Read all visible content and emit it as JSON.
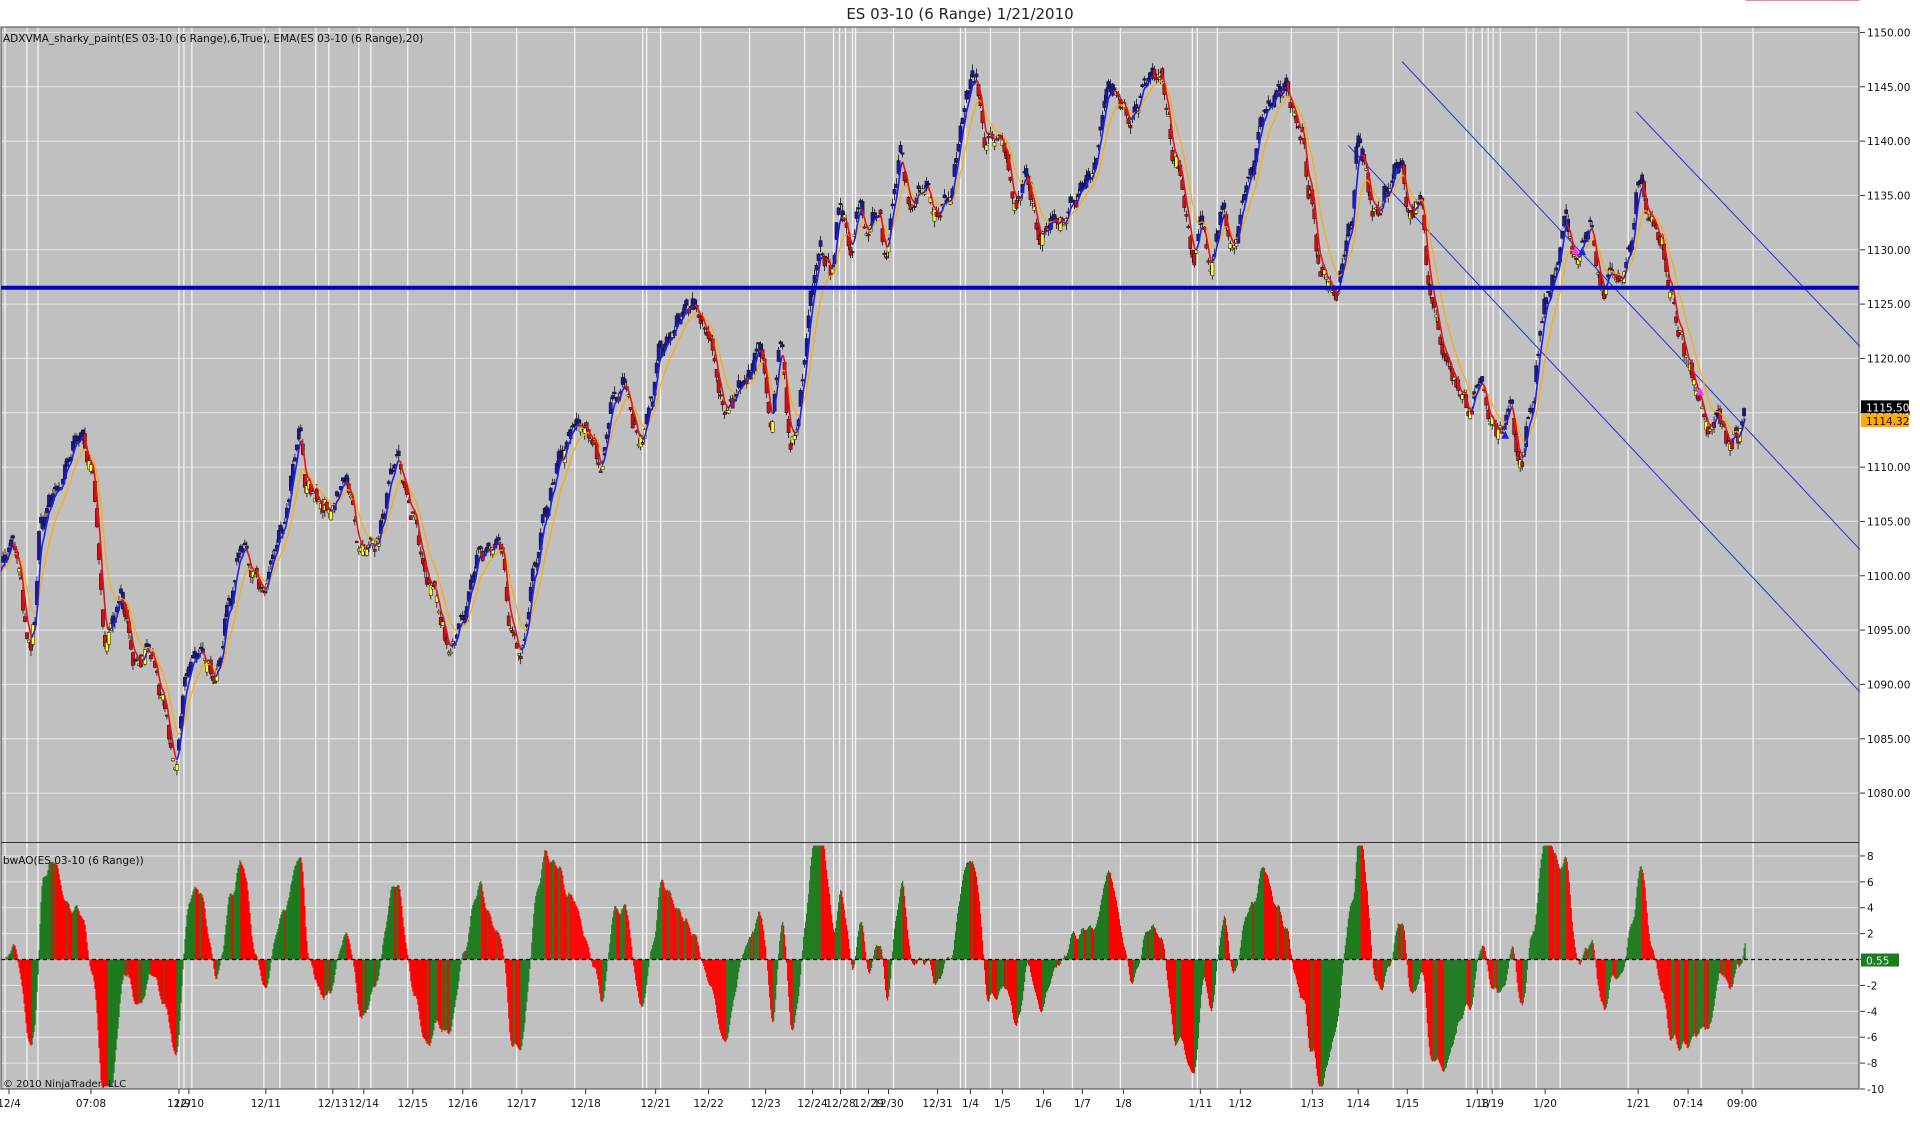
{
  "window": {
    "title": "ES 03-10 (6 Range)  1/21/2010",
    "copyright": "© 2010 NinjaTrader, LLC"
  },
  "colors": {
    "panel_bg": "#c0c0c0",
    "page_bg": "#ffffff",
    "grid": "#e6e6e6",
    "session_line": "#f4f4f4",
    "bull_candle": "#ffff33",
    "bear_candle": "#cc1111",
    "trend_up_candle": "#1a1a99",
    "adxvma_up": "#2020ee",
    "adxvma_down": "#ee1111",
    "ema": "#ffaa00",
    "support_line": "#0000cc",
    "channel": "#2233dd",
    "ao_up": "#1e7a1e",
    "ao_down": "#ff0000",
    "magenta": "#ff33ff"
  },
  "chart_data": [
    {
      "type": "candlestick",
      "panel": "price",
      "label": "ADXVMA_sharky_paint(ES 03-10 (6 Range),6,True), EMA(ES 03-10 (6 Range),20)",
      "ylim": [
        1075.5,
        1150.5
      ],
      "y_ticks": [
        "1150.00",
        "1145.00",
        "1140.00",
        "1135.00",
        "1130.00",
        "1125.00",
        "1120.00",
        "1115.00",
        "1110.00",
        "1105.00",
        "1100.00",
        "1095.00",
        "1090.00",
        "1085.00",
        "1080.00"
      ],
      "y_tick_values": [
        1150,
        1145,
        1140,
        1135,
        1130,
        1125,
        1120,
        1115,
        1110,
        1105,
        1100,
        1095,
        1090,
        1085,
        1080
      ],
      "x_labels": [
        "12/4",
        "07:08",
        "12/9",
        "12/10",
        "12/11",
        "12/13",
        "12/14",
        "12/15",
        "12/16",
        "12/17",
        "12/18",
        "12/21",
        "12/22",
        "12/23",
        "12/24",
        "12/28",
        "12/29",
        "12/30",
        "12/31",
        "1/4",
        "1/5",
        "1/6",
        "1/7",
        "1/8",
        "1/11",
        "1/12",
        "1/13",
        "1/14",
        "1/15",
        "1/18",
        "1/19",
        "1/20",
        "1/21",
        "07:14",
        "09:00"
      ],
      "x_label_bar_index": [
        8,
        90,
        178,
        188,
        265,
        332,
        363,
        412,
        462,
        521,
        585,
        655,
        708,
        765,
        812,
        840,
        868,
        888,
        937,
        970,
        1002,
        1043,
        1082,
        1123,
        1200,
        1240,
        1312,
        1358,
        1407,
        1477,
        1492,
        1545,
        1638,
        1688,
        1742
      ],
      "session_line_bar_index": [
        4,
        26,
        37,
        178,
        183,
        191,
        263,
        279,
        315,
        328,
        358,
        370,
        407,
        454,
        470,
        516,
        574,
        642,
        646,
        660,
        700,
        749,
        804,
        833,
        839,
        845,
        852,
        855,
        893,
        960,
        965,
        990,
        1019,
        1072,
        1120,
        1192,
        1197,
        1217,
        1291,
        1338,
        1393,
        1423,
        1466,
        1473,
        1482,
        1488,
        1493,
        1500,
        1536,
        1560,
        1628,
        1701,
        1753
      ],
      "close_anchor_bar_index": [
        0,
        12,
        30,
        33,
        40,
        55,
        80,
        90,
        105,
        120,
        135,
        150,
        160,
        175,
        180,
        185,
        195,
        215,
        230,
        240,
        255,
        262,
        270,
        280,
        300,
        305,
        330,
        345,
        360,
        375,
        395,
        410,
        430,
        450,
        462,
        478,
        500,
        510,
        520,
        535,
        545,
        560,
        575,
        590,
        600,
        612,
        625,
        632,
        640,
        650,
        660,
        690,
        705,
        725,
        745,
        760,
        771,
        780,
        790,
        820,
        830,
        840,
        850,
        860,
        865,
        878,
        885,
        895,
        900,
        910,
        925,
        935,
        950,
        960,
        968,
        975,
        985,
        1002,
        1015,
        1025,
        1040,
        1055,
        1062,
        1070,
        1090,
        1110,
        1130,
        1148,
        1160,
        1175,
        1195,
        1200,
        1210,
        1222,
        1232,
        1250,
        1265,
        1285,
        1300,
        1310,
        1320,
        1335,
        1350,
        1358,
        1375,
        1385,
        1400,
        1410,
        1420,
        1430,
        1445,
        1460,
        1470,
        1480,
        1492,
        1500,
        1510,
        1520,
        1530,
        1545,
        1555,
        1565,
        1575,
        1590,
        1602,
        1612,
        1620,
        1630,
        1640,
        1648,
        1660,
        1670,
        1680,
        1690,
        1700,
        1708,
        1718,
        1728,
        1738,
        1745,
        1752,
        1760
      ],
      "close_anchor_values": [
        1101,
        1103,
        1093,
        1096,
        1105,
        1108,
        1113,
        1110,
        1094,
        1098,
        1092,
        1093,
        1089,
        1082,
        1087,
        1091,
        1093,
        1091,
        1098,
        1103,
        1100,
        1098,
        1101,
        1104,
        1113,
        1108,
        1106,
        1109,
        1102,
        1103,
        1111,
        1106,
        1099,
        1093,
        1096,
        1102,
        1103,
        1095,
        1093,
        1101,
        1106,
        1111,
        1114,
        1113,
        1110,
        1116,
        1118,
        1114,
        1112,
        1116,
        1121,
        1125,
        1123,
        1115,
        1118,
        1121,
        1114,
        1122,
        1112,
        1130,
        1128,
        1134,
        1130,
        1135,
        1131,
        1134,
        1129,
        1136,
        1139,
        1134,
        1136,
        1133,
        1135,
        1141,
        1145,
        1146,
        1140,
        1140,
        1134,
        1137,
        1131,
        1133,
        1132,
        1134,
        1137,
        1145,
        1142,
        1146,
        1146,
        1138,
        1129,
        1133,
        1128,
        1134,
        1130,
        1137,
        1143,
        1145,
        1141,
        1135,
        1128,
        1126,
        1132,
        1140,
        1133,
        1135,
        1138,
        1133,
        1135,
        1126,
        1120,
        1117,
        1115,
        1118,
        1114,
        1113,
        1116,
        1110,
        1115,
        1125,
        1128,
        1133,
        1129,
        1132,
        1126,
        1128,
        1127,
        1130,
        1137,
        1133,
        1131,
        1126,
        1122,
        1119,
        1116,
        1113,
        1115,
        1112,
        1113,
        1115
      ],
      "last_price": "1115.50",
      "ema_value": "1114.32",
      "support_line": 1126.5,
      "trend_channels": [
        {
          "name": "upper",
          "start": [
            1636,
            1142.7
          ],
          "end": [
            1860,
            1121.1
          ]
        },
        {
          "name": "middle",
          "start": [
            1402,
            1147.3
          ],
          "end": [
            1860,
            1102.4
          ]
        },
        {
          "name": "lower",
          "start": [
            1348,
            1139.6
          ],
          "end": [
            1860,
            1089.3
          ]
        }
      ]
    },
    {
      "type": "histogram",
      "panel": "oscillator",
      "label": "bwAO(ES 03-10 (6 Range))",
      "ylim": [
        -10,
        9
      ],
      "y_ticks": [
        "8",
        "6",
        "4",
        "2",
        "0",
        "-2",
        "-4",
        "-6",
        "-8",
        "-10"
      ],
      "y_tick_values": [
        8,
        6,
        4,
        2,
        0,
        -2,
        -4,
        -6,
        -8,
        -10
      ],
      "zero_label": "0.55"
    }
  ]
}
